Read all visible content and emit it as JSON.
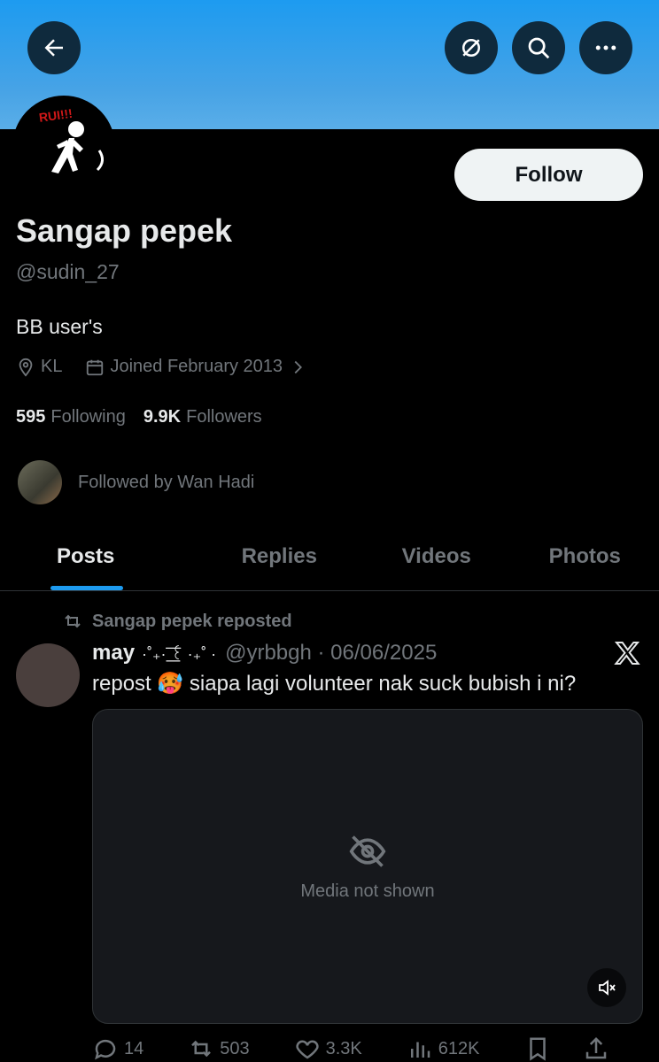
{
  "header": {
    "back_icon": "arrow-left-icon",
    "grok_icon": "grok-icon",
    "search_icon": "search-icon",
    "more_icon": "more-icon"
  },
  "profile": {
    "avatar_badge": "RUI!!!",
    "follow_label": "Follow",
    "name": "Sangap pepek",
    "handle": "@sudin_27",
    "bio": "BB user's",
    "location": "KL",
    "joined": "Joined February 2013",
    "following_count": "595",
    "following_label": "Following",
    "followers_count": "9.9K",
    "followers_label": "Followers",
    "followed_by": "Followed by Wan Hadi"
  },
  "tabs": [
    {
      "label": "Posts",
      "active": true
    },
    {
      "label": "Replies",
      "active": false
    },
    {
      "label": "Videos",
      "active": false
    },
    {
      "label": "Photos",
      "active": false
    }
  ],
  "post": {
    "repost_label": "Sangap pepek reposted",
    "author_name": "may",
    "author_deco": "·˚₊· ͟͟͞͞꒰ ·₊˚ ·",
    "author_handle_date": "@yrbbgh · 06/06/2025",
    "text": "repost 🥵 siapa lagi volunteer nak suck bubish i ni?",
    "media_placeholder": "Media not shown",
    "reply_count": "14",
    "repost_count": "503",
    "like_count": "3.3K",
    "view_count": "612K"
  },
  "colors": {
    "accent": "#1d9bf0",
    "banner": "#1d9bf0",
    "background": "#000000",
    "muted_text": "#71767b"
  }
}
